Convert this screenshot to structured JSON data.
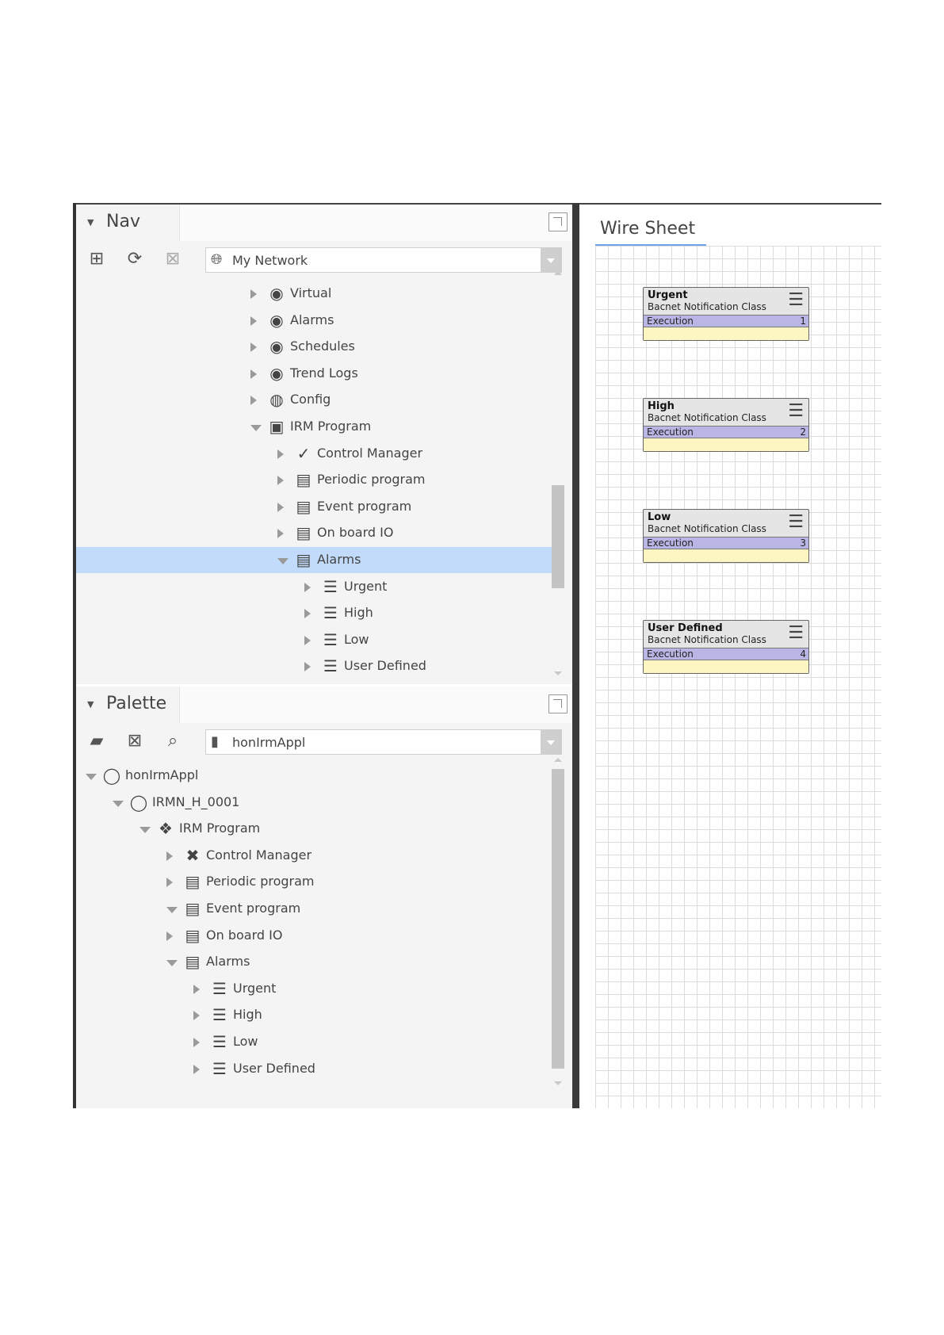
{
  "nav": {
    "title": "Nav",
    "combo_value": "My Network",
    "tree": [
      {
        "label": "Virtual",
        "icon": "virtual-icon",
        "glyph": "◉",
        "arrow": "right",
        "depth": 0
      },
      {
        "label": "Alarms",
        "icon": "alarm-bell-icon",
        "glyph": "◉",
        "arrow": "right",
        "depth": 0
      },
      {
        "label": "Schedules",
        "icon": "calendar-icon",
        "glyph": "◉",
        "arrow": "right",
        "depth": 0
      },
      {
        "label": "Trend Logs",
        "icon": "trend-icon",
        "glyph": "◉",
        "arrow": "right",
        "depth": 0
      },
      {
        "label": "Config",
        "icon": "config-icon",
        "glyph": "◍",
        "arrow": "right",
        "depth": 0
      },
      {
        "label": "IRM Program",
        "icon": "program-folder-icon",
        "glyph": "▣",
        "arrow": "down",
        "depth": 0
      },
      {
        "label": "Control Manager",
        "icon": "checkmark-icon",
        "glyph": "✓",
        "arrow": "right",
        "depth": 1
      },
      {
        "label": "Periodic program",
        "icon": "program-file-icon",
        "glyph": "▤",
        "arrow": "right",
        "depth": 1
      },
      {
        "label": "Event program",
        "icon": "program-file-icon",
        "glyph": "▤",
        "arrow": "right",
        "depth": 1
      },
      {
        "label": "On board IO",
        "icon": "program-file-icon",
        "glyph": "▤",
        "arrow": "right",
        "depth": 1
      },
      {
        "label": "Alarms",
        "icon": "program-file-icon",
        "glyph": "▤",
        "arrow": "down",
        "depth": 1,
        "selected": true
      },
      {
        "label": "Urgent",
        "icon": "notification-class-icon",
        "glyph": "☰",
        "arrow": "right",
        "depth": 2
      },
      {
        "label": "High",
        "icon": "notification-class-icon",
        "glyph": "☰",
        "arrow": "right",
        "depth": 2
      },
      {
        "label": "Low",
        "icon": "notification-class-icon",
        "glyph": "☰",
        "arrow": "right",
        "depth": 2
      },
      {
        "label": "User Defined",
        "icon": "notification-class-icon",
        "glyph": "☰",
        "arrow": "right",
        "depth": 2
      }
    ]
  },
  "palette": {
    "title": "Palette",
    "combo_value": "honIrmAppl",
    "tree": [
      {
        "label": "honIrmAppl",
        "icon": "module-icon",
        "glyph": "◯",
        "arrow": "down",
        "depth": 0
      },
      {
        "label": "IRMN_H_0001",
        "icon": "device-icon",
        "glyph": "◯",
        "arrow": "down",
        "depth": 1
      },
      {
        "label": "IRM Program",
        "icon": "program-group-icon",
        "glyph": "❖",
        "arrow": "down",
        "depth": 2
      },
      {
        "label": "Control Manager",
        "icon": "cross-icon",
        "glyph": "✖",
        "arrow": "right",
        "depth": 3
      },
      {
        "label": "Periodic program",
        "icon": "program-file-icon",
        "glyph": "▤",
        "arrow": "right",
        "depth": 3
      },
      {
        "label": "Event program",
        "icon": "program-file-icon",
        "glyph": "▤",
        "arrow": "down",
        "depth": 3
      },
      {
        "label": "On board IO",
        "icon": "program-file-icon",
        "glyph": "▤",
        "arrow": "right",
        "depth": 3
      },
      {
        "label": "Alarms",
        "icon": "program-file-icon",
        "glyph": "▤",
        "arrow": "down",
        "depth": 3
      },
      {
        "label": "Urgent",
        "icon": "notification-class-icon",
        "glyph": "☰",
        "arrow": "right",
        "depth": 4
      },
      {
        "label": "High",
        "icon": "notification-class-icon",
        "glyph": "☰",
        "arrow": "right",
        "depth": 4
      },
      {
        "label": "Low",
        "icon": "notification-class-icon",
        "glyph": "☰",
        "arrow": "right",
        "depth": 4
      },
      {
        "label": "User Defined",
        "icon": "notification-class-icon",
        "glyph": "☰",
        "arrow": "right",
        "depth": 4
      }
    ]
  },
  "wiresheet": {
    "title": "Wire Sheet",
    "blocks": [
      {
        "name": "Urgent",
        "type": "Bacnet Notification Class",
        "exec_label": "Execution",
        "exec_value": "1"
      },
      {
        "name": "High",
        "type": "Bacnet Notification Class",
        "exec_label": "Execution",
        "exec_value": "2"
      },
      {
        "name": "Low",
        "type": "Bacnet Notification Class",
        "exec_label": "Execution",
        "exec_value": "3"
      },
      {
        "name": "User Defined",
        "type": "Bacnet Notification Class",
        "exec_label": "Execution",
        "exec_value": "4"
      }
    ]
  },
  "colors": {
    "selection": "#c3dbfa",
    "exec_bar": "#b9b6e6",
    "block_footer": "#fdf6c2",
    "tab_underline": "#6fa3e8"
  }
}
